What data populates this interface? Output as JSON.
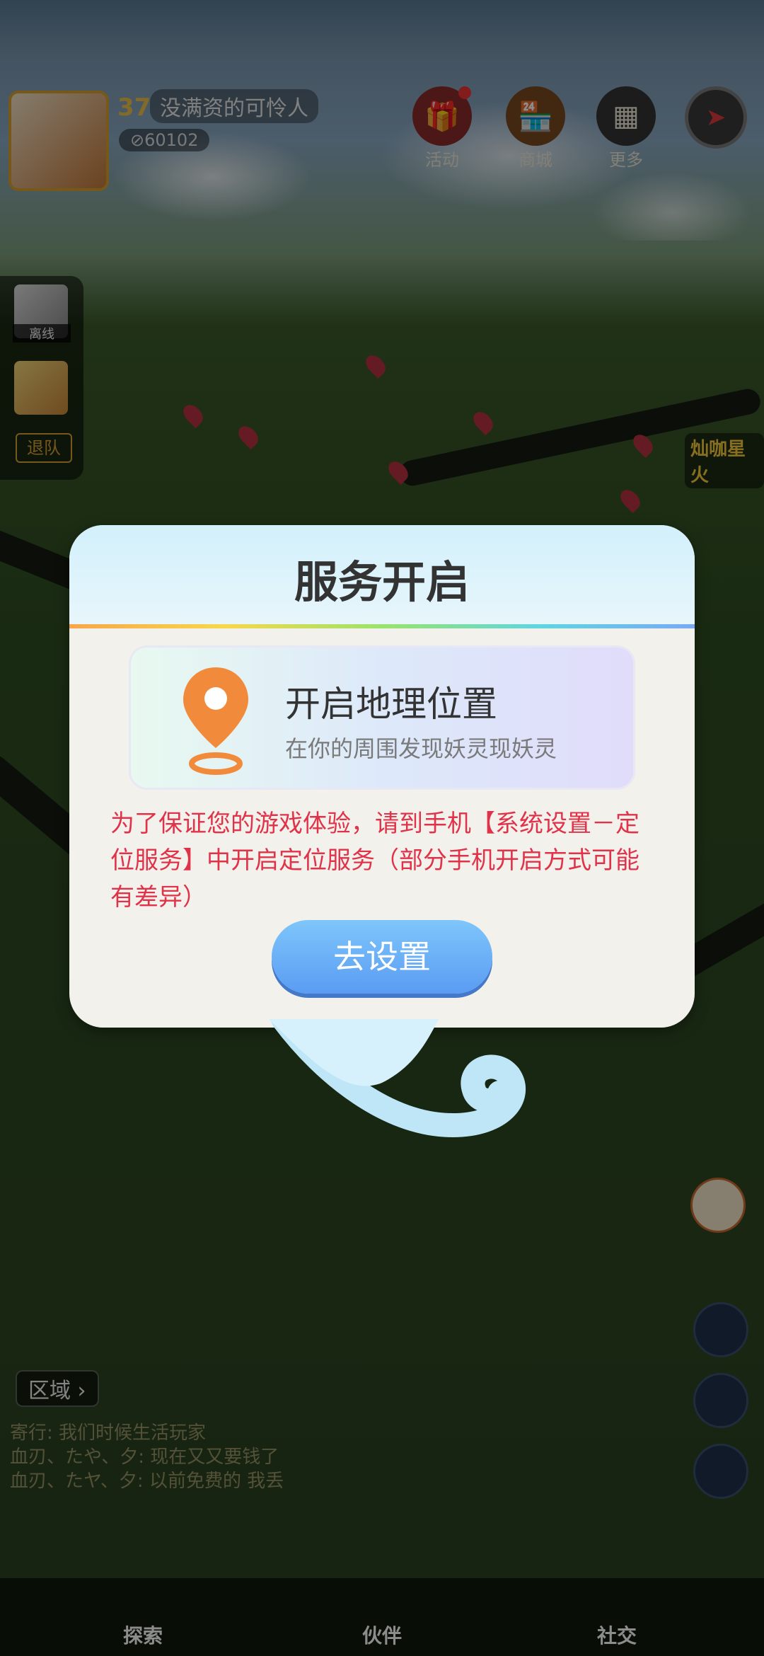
{
  "player": {
    "level": "37",
    "name": "没满资的可怜人",
    "coins": "⊘60102"
  },
  "hud": {
    "activity": {
      "label": "活动",
      "icon": "gift-icon"
    },
    "shop": {
      "label": "商城",
      "icon": "shop-icon"
    },
    "more": {
      "label": "更多",
      "icon": "grid-icon"
    },
    "compass_icon": "compass-icon"
  },
  "side": {
    "offline_label": "离线",
    "leave_team": "退队"
  },
  "map_label": "灿咖星火",
  "dialog": {
    "title": "服务开启",
    "card_title": "开启地理位置",
    "card_subtitle": "在你的周围发现妖灵现妖灵",
    "message": "为了保证您的游戏体验，请到手机【系统设置－定位服务】中开启定位服务（部分手机开启方式可能有差异）",
    "button": "去设置"
  },
  "region": {
    "label": "区域 ›"
  },
  "chat": [
    "寄行: 我们时候生活玩家",
    "血刃、たや、夕: 现在又又要钱了",
    "血刃、たヤ、夕: 以前免费的 我丢"
  ],
  "bottom_nav": [
    {
      "label": "探索",
      "icon": "explore-icon"
    },
    {
      "label": "伙伴",
      "icon": "partner-icon"
    },
    {
      "label": "社交",
      "icon": "social-icon"
    }
  ],
  "colors": {
    "accent_blue": "#5a9cf3",
    "warning_red": "#e0334a",
    "pin_orange": "#f28a3c"
  }
}
